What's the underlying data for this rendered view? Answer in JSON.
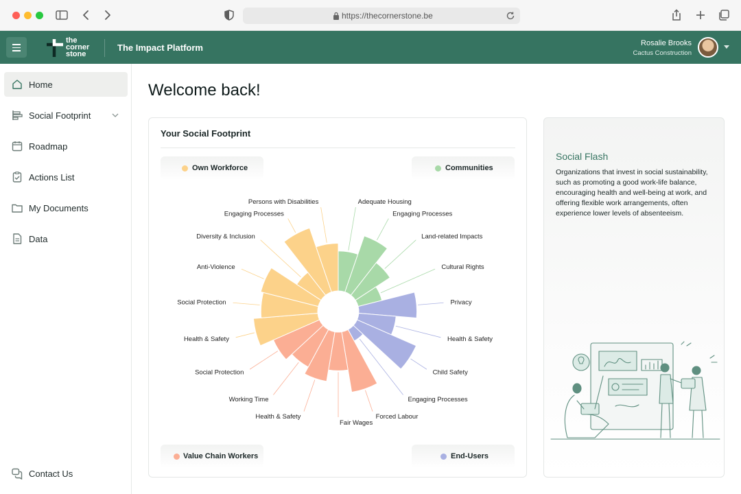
{
  "browser": {
    "url": "https://thecornerstone.be"
  },
  "header": {
    "logo_lines": [
      "the",
      "corner",
      "stone"
    ],
    "platform_title": "The Impact Platform",
    "user_name": "Rosalie Brooks",
    "user_company": "Cactus Construction"
  },
  "sidebar": {
    "items": [
      {
        "label": "Home",
        "icon": "home-icon",
        "active": true
      },
      {
        "label": "Social Footprint",
        "icon": "chart-bars-icon",
        "expandable": true
      },
      {
        "label": "Roadmap",
        "icon": "calendar-icon"
      },
      {
        "label": "Actions List",
        "icon": "clipboard-check-icon"
      },
      {
        "label": "My Documents",
        "icon": "folder-icon"
      },
      {
        "label": "Data",
        "icon": "document-icon"
      }
    ],
    "contact_label": "Contact Us"
  },
  "main": {
    "welcome": "Welcome back!"
  },
  "footprint_card": {
    "title": "Your Social Footprint",
    "legend": [
      {
        "label": "Own Workforce",
        "color": "#fcd28a"
      },
      {
        "label": "Communities",
        "color": "#a8d9a8"
      },
      {
        "label": "Value Chain Workers",
        "color": "#fbae94"
      },
      {
        "label": "End-Users",
        "color": "#a9b0e2"
      }
    ]
  },
  "chart_data": {
    "type": "polar-area",
    "categories": [
      {
        "label": "Adequate Housing",
        "group": "Communities",
        "value": 0.62
      },
      {
        "label": "Engaging Processes",
        "group": "Communities",
        "value": 0.92
      },
      {
        "label": "Land-related Impacts",
        "group": "Communities",
        "value": 0.64
      },
      {
        "label": "Cultural Rights",
        "group": "Communities",
        "value": 0.38
      },
      {
        "label": "Privacy",
        "group": "End-Users",
        "value": 0.9
      },
      {
        "label": "Health & Safety",
        "group": "End-Users",
        "value": 0.58
      },
      {
        "label": "Child Safety",
        "group": "End-Users",
        "value": 1.0
      },
      {
        "label": "Engaging Processes",
        "group": "End-Users",
        "value": 0.2
      },
      {
        "label": "Forced Labour",
        "group": "Value Chain Workers",
        "value": 0.95
      },
      {
        "label": "Fair Wages",
        "group": "Value Chain Workers",
        "value": 0.6
      },
      {
        "label": "Health & Safety",
        "group": "Value Chain Workers",
        "value": 0.78
      },
      {
        "label": "Working Time",
        "group": "Value Chain Workers",
        "value": 0.66
      },
      {
        "label": "Social Protection",
        "group": "Value Chain Workers",
        "value": 0.78
      },
      {
        "label": "Health & Safety",
        "group": "Own Workforce",
        "value": 1.0
      },
      {
        "label": "Social Protection",
        "group": "Own Workforce",
        "value": 0.88
      },
      {
        "label": "Anti-Violence",
        "group": "Own Workforce",
        "value": 0.92
      },
      {
        "label": "Diversity & Inclusion",
        "group": "Own Workforce",
        "value": 0.45
      },
      {
        "label": "Engaging Processes",
        "group": "Own Workforce",
        "value": 1.05
      },
      {
        "label": "Persons with Disabilities",
        "group": "Own Workforce",
        "value": 0.74
      }
    ]
  },
  "social_flash": {
    "title": "Social Flash",
    "body": "Organizations that invest in social sustainability, such as promoting a good work-life balance, encouraging health and well-being at work, and offering flexible work arrangements, often experience lower levels of absenteeism."
  }
}
